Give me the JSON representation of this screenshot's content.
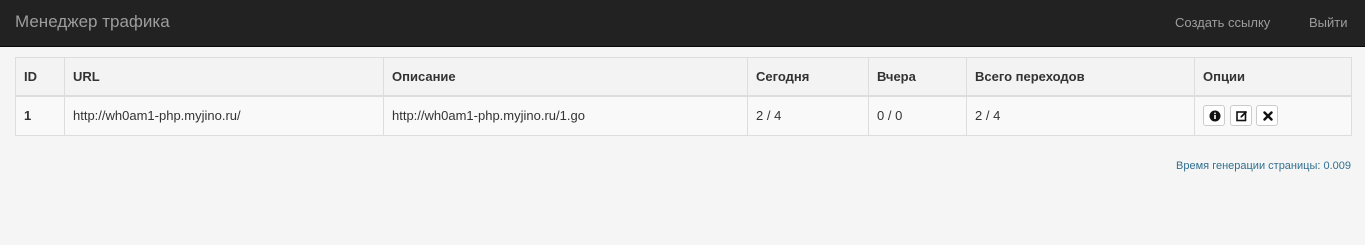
{
  "navbar": {
    "brand": "Менеджер трафика",
    "create_link": "Создать ссылку",
    "logout": "Выйти"
  },
  "table": {
    "headers": [
      "ID",
      "URL",
      "Описание",
      "Сегодня",
      "Вчера",
      "Всего переходов",
      "Опции"
    ],
    "rows": [
      {
        "id": "1",
        "url": "http://wh0am1-php.myjino.ru/",
        "description": "http://wh0am1-php.myjino.ru/1.go",
        "today": "2 / 4",
        "yesterday": "0 / 0",
        "total": "2 / 4",
        "options": [
          "info-icon",
          "edit-icon",
          "delete-icon"
        ]
      }
    ]
  },
  "footer": {
    "generation_time": "Время генерации страницы: 0.009"
  }
}
